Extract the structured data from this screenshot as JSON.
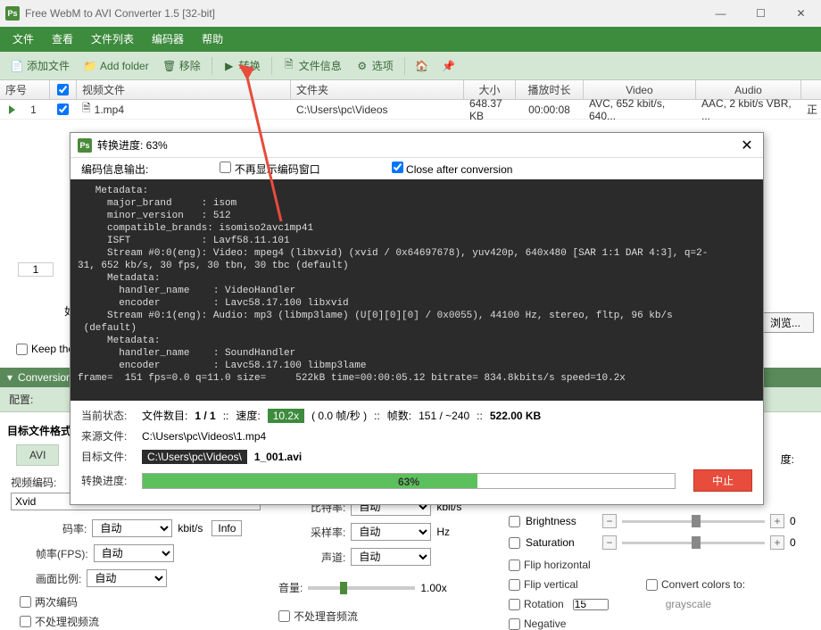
{
  "titlebar": {
    "title": "Free WebM to AVI Converter 1.5  [32-bit]",
    "icon_text": "Ps"
  },
  "menubar": {
    "items": [
      "文件",
      "查看",
      "文件列表",
      "编码器",
      "帮助"
    ]
  },
  "toolbar": {
    "add_file": "添加文件",
    "add_folder": "Add folder",
    "remove": "移除",
    "convert": "转换",
    "file_info": "文件信息",
    "options": "选项"
  },
  "columns": {
    "seq": "序号",
    "video_file": "视频文件",
    "folder": "文件夹",
    "size": "大小",
    "duration": "播放时长",
    "video": "Video",
    "audio": "Audio"
  },
  "row1": {
    "seq": "1",
    "file": "1.mp4",
    "folder": "C:\\Users\\pc\\Videos",
    "size": "648.37 KB",
    "duration": "00:00:08",
    "video": "AVC, 652 kbit/s, 640...",
    "audio": "AAC, 2 kbit/s VBR, ...",
    "end": "正"
  },
  "lower_index": "1",
  "if_label": "如果",
  "browse": "浏览...",
  "keep": "Keep the",
  "conversion_label": "Conversion",
  "config_label": "配置:",
  "target_file_label": "目标文件格式",
  "avi_tab": "AVI",
  "video_encode_label": "视频编码:",
  "xvid": "Xvid",
  "bitrate_label": "码率:",
  "fps_label": "帧率(FPS):",
  "aspect_label": "画面比例:",
  "auto": "自动",
  "kbits": "kbit/s",
  "info": "Info",
  "two_pass": "两次编码",
  "no_video": "不处理视频流",
  "br_label2": "比特率:",
  "sample_rate": "采样率:",
  "channel": "声道:",
  "hz": "Hz",
  "volume": "音量:",
  "vol_val": "1.00x",
  "no_audio": "不处理音频流",
  "brightness": "Brightness",
  "saturation": "Saturation",
  "flip_h": "Flip horizontal",
  "flip_v": "Flip vertical",
  "rotation": "Rotation",
  "rot_val": "15",
  "negative": "Negative",
  "convert_colors": "Convert colors to:",
  "grayscale": "grayscale",
  "zero": "0",
  "deg_label": "度:",
  "dialog": {
    "title": "转换进度: 63%",
    "opt_label": "编码信息输出:",
    "no_show": "不再显示编码窗口",
    "close_after": "Close after conversion",
    "console_text": "   Metadata:\n     major_brand     : isom\n     minor_version   : 512\n     compatible_brands: isomiso2avc1mp41\n     ISFT            : Lavf58.11.101\n     Stream #0:0(eng): Video: mpeg4 (libxvid) (xvid / 0x64697678), yuv420p, 640x480 [SAR 1:1 DAR 4:3], q=2-\n31, 652 kb/s, 30 fps, 30 tbn, 30 tbc (default)\n     Metadata:\n       handler_name    : VideoHandler\n       encoder         : Lavc58.17.100 libxvid\n     Stream #0:1(eng): Audio: mp3 (libmp3lame) (U[0][0][0] / 0x0055), 44100 Hz, stereo, fltp, 96 kb/s\n (default)\n     Metadata:\n       handler_name    : SoundHandler\n       encoder         : Lavc58.17.100 libmp3lame\nframe=  151 fps=0.0 q=11.0 size=     522kB time=00:00:05.12 bitrate= 834.8kbits/s speed=10.2x",
    "status_label": "当前状态:",
    "file_count_label": "文件数目:",
    "file_count": "1 / 1",
    "speed_label": "速度:",
    "speed": "10.2x",
    "fps_paren": "( 0.0 帧/秒 )",
    "frames_label": "帧数:",
    "frames": "151 / ~240",
    "out_size": "522.00 KB",
    "src_label": "来源文件:",
    "src": "C:\\Users\\pc\\Videos\\1.mp4",
    "tgt_label": "目标文件:",
    "tgt_dir": "C:\\Users\\pc\\Videos\\",
    "tgt_name": "1_001.avi",
    "prog_label": "转换进度:",
    "prog_pct": "63%",
    "stop": "中止",
    "sep": "::"
  }
}
